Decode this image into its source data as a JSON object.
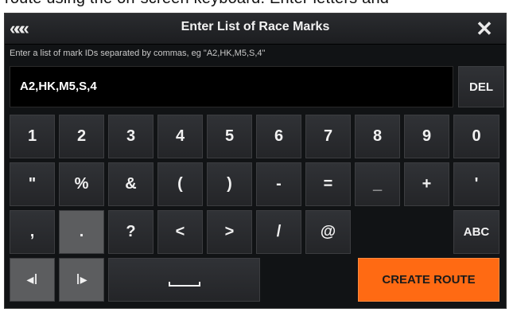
{
  "background_caption": "route using the on-screen keyboard. Enter letters and",
  "titlebar": {
    "back_icon": "«««",
    "title": "Enter List of Race Marks",
    "close_icon": "✕"
  },
  "hint": "Enter a list of mark IDs separated by commas, eg \"A2,HK,M5,S,4\"",
  "entry": {
    "value": "A2,HK,M5,S,4"
  },
  "keys": {
    "del": "DEL",
    "row1": [
      "1",
      "2",
      "3",
      "4",
      "5",
      "6",
      "7",
      "8",
      "9",
      "0"
    ],
    "row2": [
      "\"",
      "%",
      "&",
      "(",
      ")",
      "-",
      "=",
      "_",
      "+",
      "'"
    ],
    "row3": [
      ",",
      ".",
      "?",
      "<",
      ">",
      "/",
      "@"
    ],
    "abc": "ABC",
    "cursor_left": "◂Ⅰ",
    "cursor_right": "Ⅰ▸",
    "create_route": "CREATE ROUTE"
  }
}
